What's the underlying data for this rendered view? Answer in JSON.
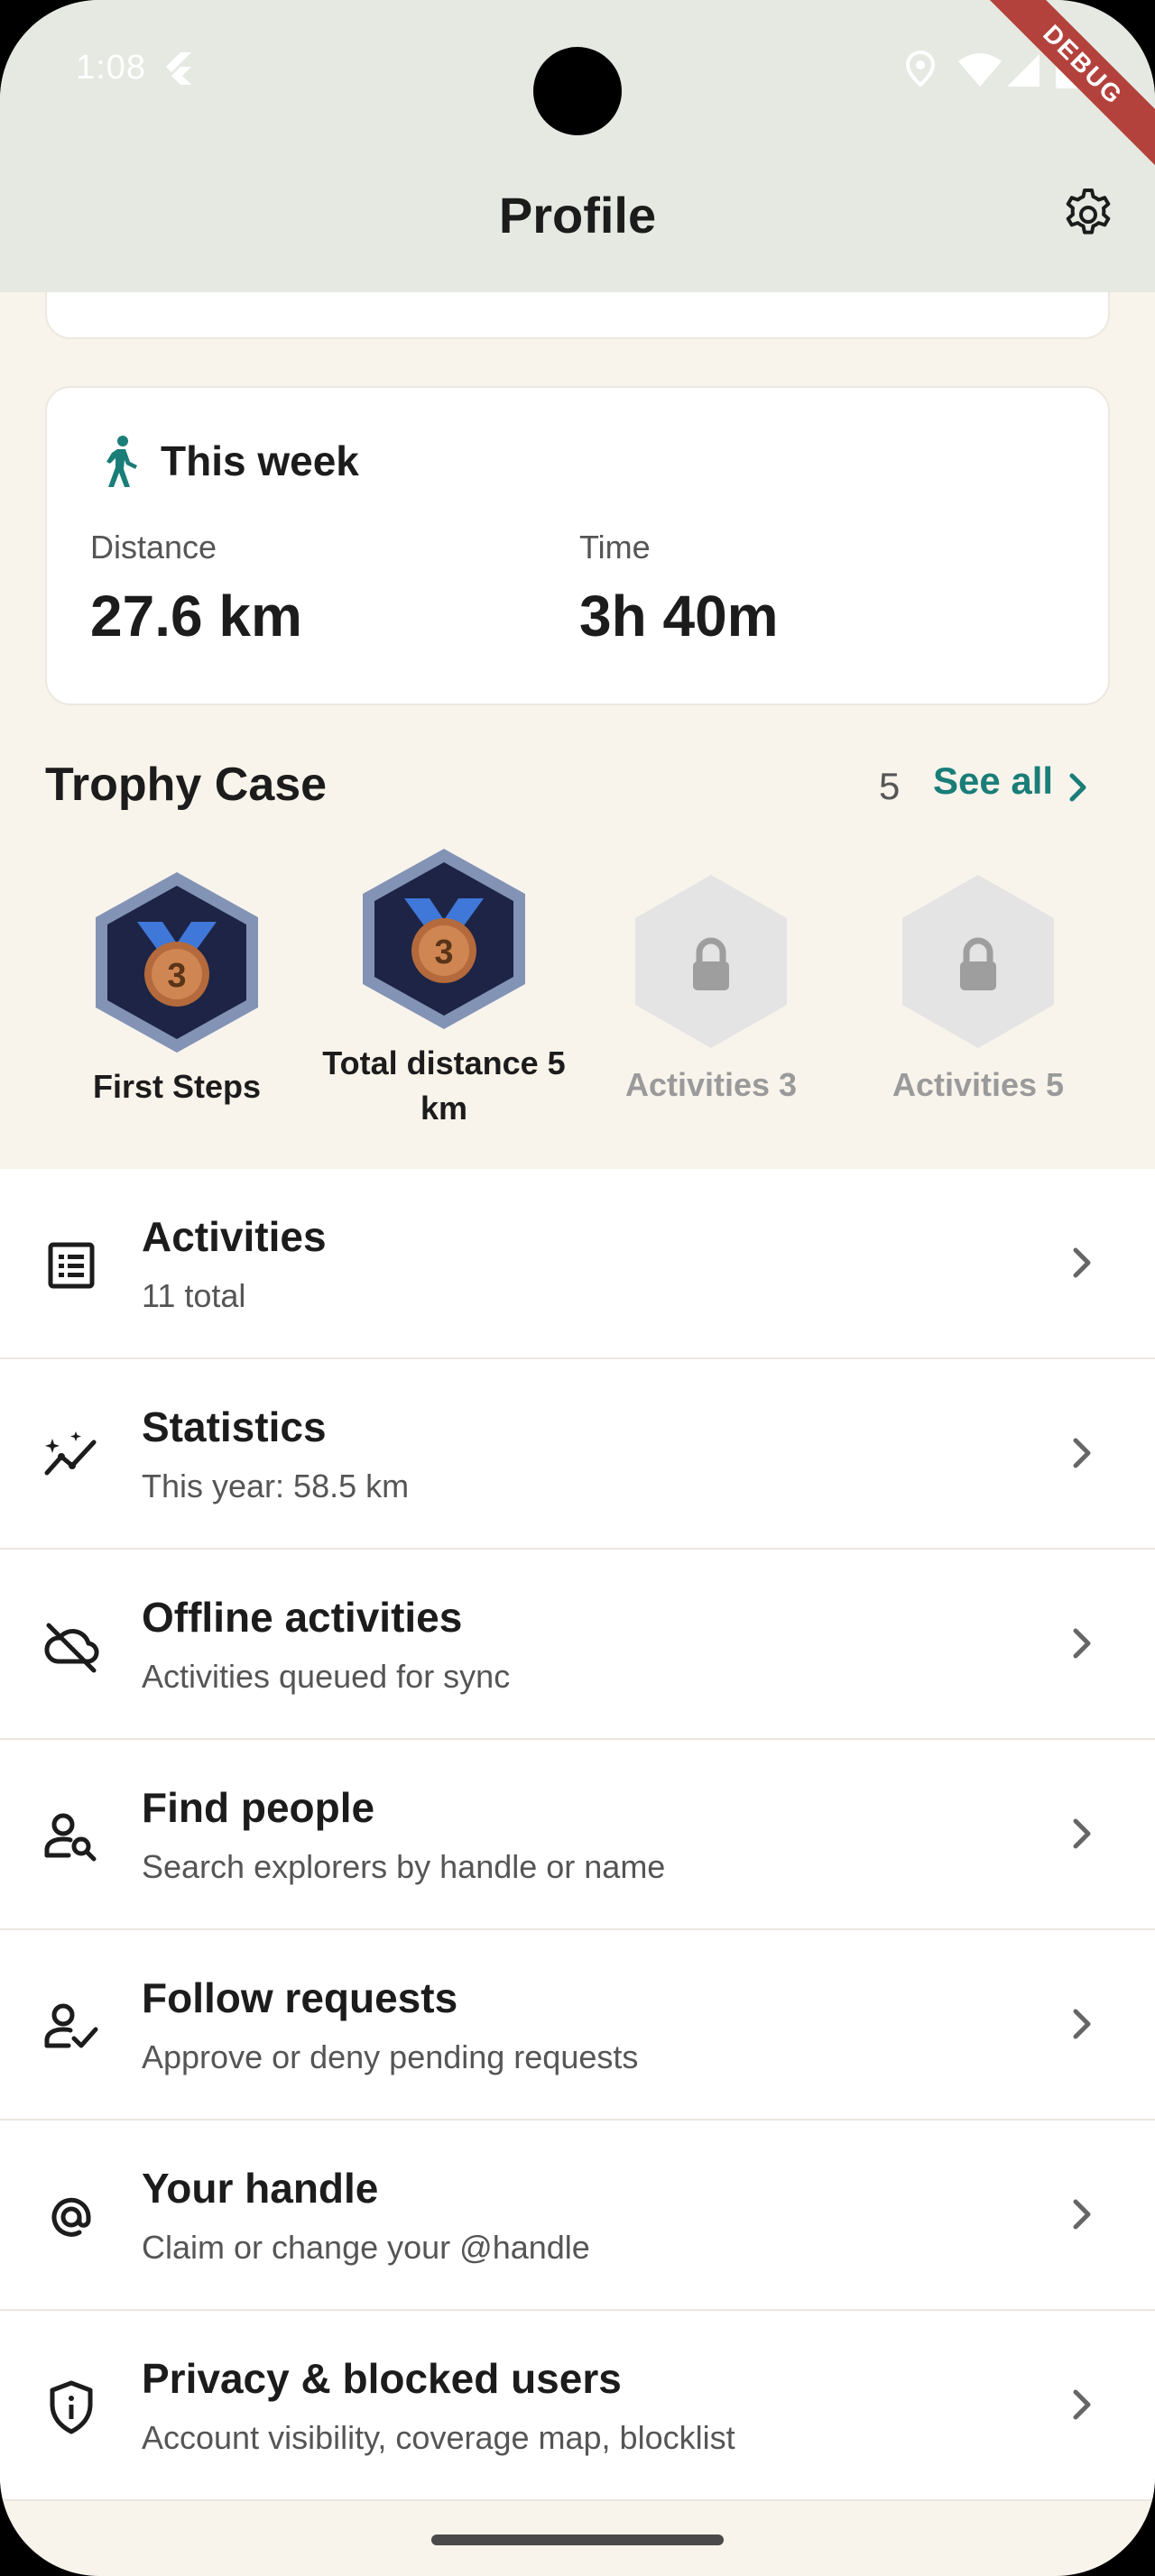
{
  "status_bar": {
    "time": "1:08"
  },
  "app_bar": {
    "title": "Profile",
    "debug_label": "DEBUG"
  },
  "this_week": {
    "title": "This week",
    "distance_label": "Distance",
    "distance_value": "27.6 km",
    "time_label": "Time",
    "time_value": "3h 40m"
  },
  "trophy_case": {
    "title": "Trophy Case",
    "count": "5",
    "see_all": "See all",
    "badges": [
      {
        "label": "First Steps",
        "locked": false,
        "level": "3"
      },
      {
        "label": "Total distance 5 km",
        "locked": false,
        "level": "3"
      },
      {
        "label": "Activities 3",
        "locked": true
      },
      {
        "label": "Activities 5",
        "locked": true
      }
    ]
  },
  "menu": [
    {
      "title": "Activities",
      "subtitle": "11 total",
      "icon": "list-icon"
    },
    {
      "title": "Statistics",
      "subtitle": "This year: 58.5 km",
      "icon": "trending-icon"
    },
    {
      "title": "Offline activities",
      "subtitle": "Activities queued for sync",
      "icon": "cloud-off-icon"
    },
    {
      "title": "Find people",
      "subtitle": "Search explorers by handle or name",
      "icon": "person-search-icon"
    },
    {
      "title": "Follow requests",
      "subtitle": "Approve or deny pending requests",
      "icon": "person-check-icon"
    },
    {
      "title": "Your handle",
      "subtitle": "Claim or change your @handle",
      "icon": "at-icon"
    },
    {
      "title": "Privacy & blocked users",
      "subtitle": "Account visibility, coverage map, blocklist",
      "icon": "shield-icon"
    }
  ],
  "colors": {
    "accent": "#1a7d78",
    "badge_dark": "#1d2445",
    "badge_rim": "#8393b5",
    "medal": "#c8794a",
    "locked": "#e4e4e4"
  }
}
